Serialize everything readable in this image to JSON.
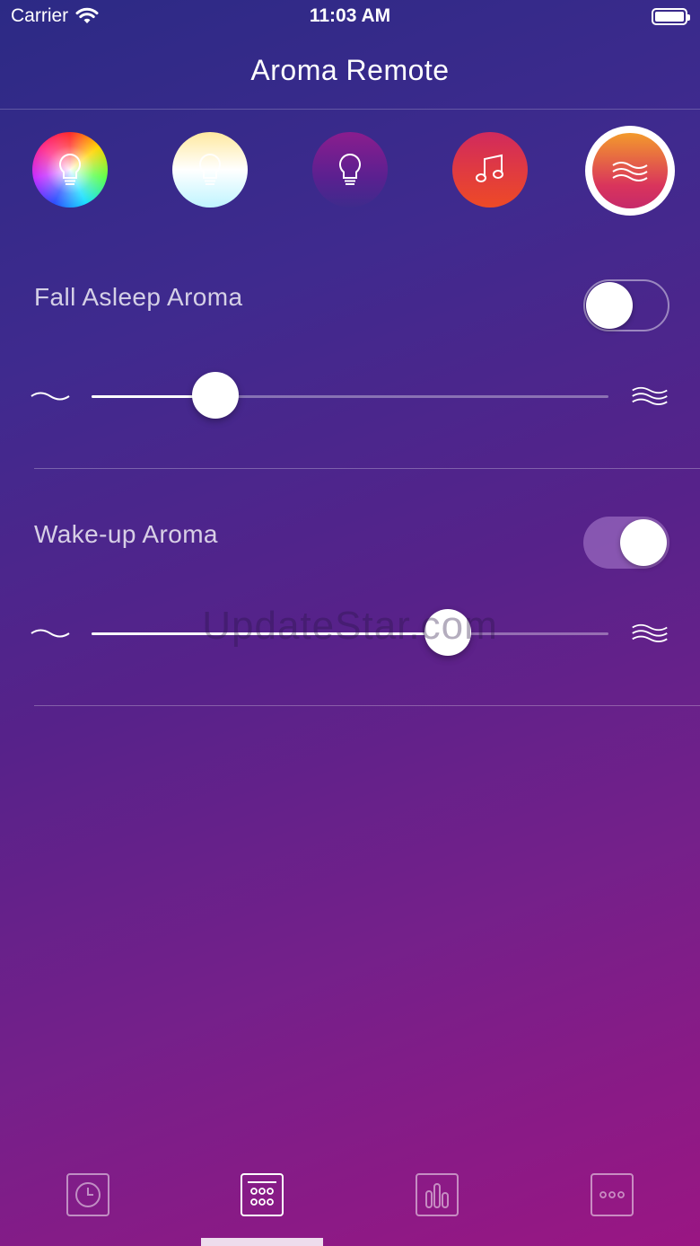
{
  "status_bar": {
    "carrier": "Carrier",
    "time": "11:03 AM"
  },
  "nav": {
    "title": "Aroma Remote"
  },
  "modes": [
    {
      "name": "color-light",
      "icon": "bulb-icon",
      "selected": false
    },
    {
      "name": "white-light",
      "icon": "bulb-icon",
      "selected": false
    },
    {
      "name": "night-light",
      "icon": "bulb-icon",
      "selected": false
    },
    {
      "name": "music",
      "icon": "music-note-icon",
      "selected": false
    },
    {
      "name": "aroma",
      "icon": "waves-icon",
      "selected": true
    }
  ],
  "fall_asleep": {
    "label": "Fall Asleep Aroma",
    "enabled": false,
    "intensity_percent": 24,
    "min_icon": "wave-low-icon",
    "max_icon": "wave-high-icon"
  },
  "wake_up": {
    "label": "Wake-up Aroma",
    "enabled": true,
    "intensity_percent": 69,
    "min_icon": "wave-low-icon",
    "max_icon": "wave-high-icon"
  },
  "watermark": "UpdateStar.com",
  "tabs": [
    {
      "name": "timer",
      "icon": "clock-icon",
      "selected": false
    },
    {
      "name": "remote",
      "icon": "keypad-icon",
      "selected": true
    },
    {
      "name": "stats",
      "icon": "bars-icon",
      "selected": false
    },
    {
      "name": "more",
      "icon": "more-icon",
      "selected": false
    }
  ],
  "colors": {
    "background_top": "#2c2a85",
    "background_bottom": "#9a1683",
    "aroma_accent": "#f39a2c",
    "music_accent": "#ee4a26"
  }
}
